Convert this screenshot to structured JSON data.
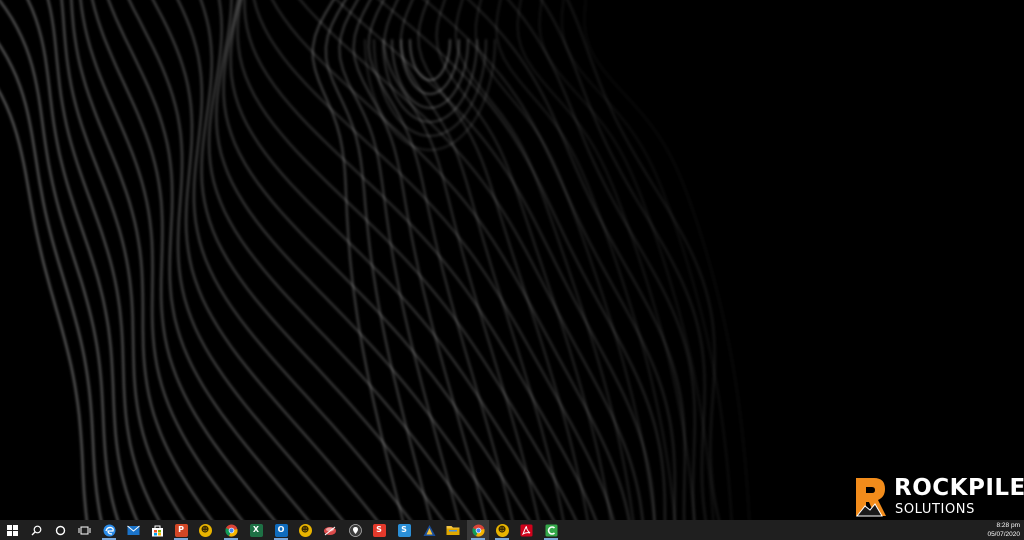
{
  "logo": {
    "line1": "ROCKPILE",
    "line2": "SOLUTIONS",
    "accent": "#f28c1b"
  },
  "taskbar": {
    "background": "#1f1f1f",
    "pinned": [
      {
        "name": "start-button",
        "icon": "windows-logo-icon"
      },
      {
        "name": "search-button",
        "icon": "search-icon"
      },
      {
        "name": "cortana-button",
        "icon": "cortana-ring-icon"
      },
      {
        "name": "task-view-button",
        "icon": "task-view-icon"
      },
      {
        "name": "taskbar-app-edge",
        "icon": "edge-icon",
        "color": "#2a8be8"
      },
      {
        "name": "taskbar-app-mail",
        "icon": "mail-icon",
        "color": "#1a73c9"
      },
      {
        "name": "taskbar-app-store",
        "icon": "store-bag-icon",
        "color": "#ffb900"
      },
      {
        "name": "taskbar-app-powerpoint",
        "icon": "powerpoint-icon",
        "color": "#d24726"
      },
      {
        "name": "taskbar-app-yellow-1",
        "icon": "yellow-circle-app-icon",
        "color": "#e8b400"
      },
      {
        "name": "taskbar-app-chrome",
        "icon": "chrome-icon"
      },
      {
        "name": "taskbar-app-excel",
        "icon": "excel-icon",
        "color": "#1e7145"
      },
      {
        "name": "taskbar-app-outlook",
        "icon": "outlook-icon",
        "color": "#0f6cbd"
      },
      {
        "name": "taskbar-app-yellow-2",
        "icon": "yellow-circle-app-icon",
        "color": "#e8b400"
      },
      {
        "name": "taskbar-app-snip",
        "icon": "snip-tool-icon",
        "color": "#d94a4a"
      },
      {
        "name": "taskbar-app-maps",
        "icon": "map-pin-icon",
        "color": "#3d3d3d"
      },
      {
        "name": "taskbar-app-yellow-3",
        "icon": "yellow-circle-app-icon",
        "color": "#e8b400"
      },
      {
        "name": "taskbar-app-snagit",
        "icon": "snagit-icon",
        "color": "#e4392b"
      },
      {
        "name": "taskbar-app-s-blue",
        "icon": "s-blue-app-icon",
        "color": "#2b8fd6"
      },
      {
        "name": "taskbar-app-vpn",
        "icon": "warning-shield-icon",
        "color": "#1b4f9c"
      },
      {
        "name": "taskbar-app-file-explorer",
        "icon": "folder-icon",
        "color": "#f4c542"
      },
      {
        "name": "taskbar-app-chrome-2",
        "icon": "chrome-icon"
      },
      {
        "name": "taskbar-app-yellow-4",
        "icon": "yellow-circle-app-icon",
        "color": "#e8b400"
      },
      {
        "name": "taskbar-app-acrobat",
        "icon": "acrobat-icon",
        "color": "#d0021b"
      },
      {
        "name": "taskbar-app-camtasia",
        "icon": "camtasia-icon",
        "color": "#35a84a"
      }
    ],
    "clock": {
      "time": "8:28 pm",
      "date": "05/07/2020"
    }
  }
}
